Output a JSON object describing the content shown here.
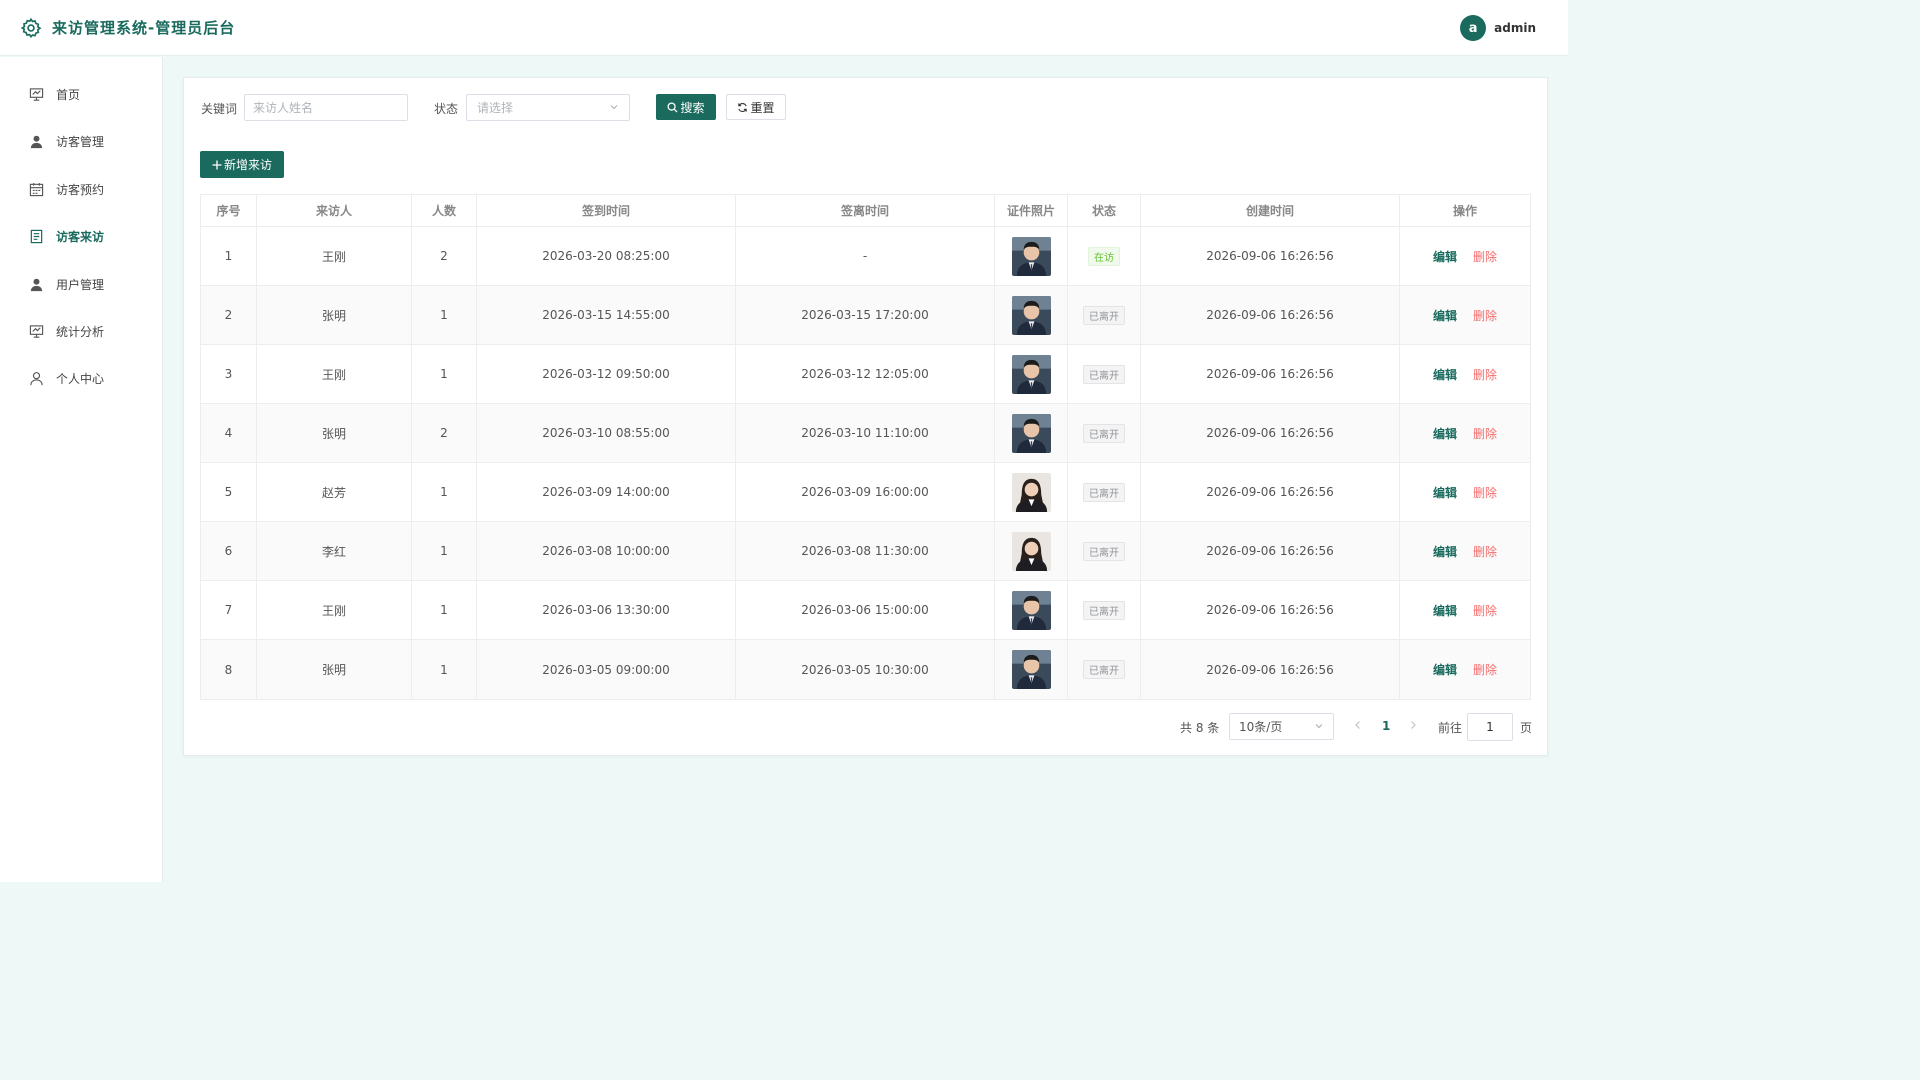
{
  "app": {
    "title": "来访管理系统-管理员后台"
  },
  "user": {
    "avatar_letter": "a",
    "name": "admin"
  },
  "sidebar": {
    "items": [
      {
        "label": "首页",
        "icon": "presentation-icon"
      },
      {
        "label": "访客管理",
        "icon": "user-icon"
      },
      {
        "label": "访客预约",
        "icon": "calendar-icon"
      },
      {
        "label": "访客来访",
        "icon": "document-icon",
        "active": true
      },
      {
        "label": "用户管理",
        "icon": "user-icon"
      },
      {
        "label": "统计分析",
        "icon": "presentation-icon"
      },
      {
        "label": "个人中心",
        "icon": "user-outline-icon"
      }
    ]
  },
  "filters": {
    "keyword_label": "关键词",
    "keyword_placeholder": "来访人姓名",
    "status_label": "状态",
    "status_placeholder": "请选择",
    "search_label": "搜索",
    "reset_label": "重置"
  },
  "toolbar": {
    "add_label": "新增来访"
  },
  "table": {
    "columns": [
      "序号",
      "来访人",
      "人数",
      "签到时间",
      "签离时间",
      "证件照片",
      "状态",
      "创建时间",
      "操作"
    ],
    "rows": [
      {
        "idx": "1",
        "name": "王刚",
        "count": "2",
        "checkin": "2026-03-20 08:25:00",
        "checkout": "-",
        "photo": "male",
        "status": "在访",
        "status_type": "in",
        "created": "2026-09-06 16:26:56"
      },
      {
        "idx": "2",
        "name": "张明",
        "count": "1",
        "checkin": "2026-03-15 14:55:00",
        "checkout": "2026-03-15 17:20:00",
        "photo": "male",
        "status": "已离开",
        "status_type": "out",
        "created": "2026-09-06 16:26:56"
      },
      {
        "idx": "3",
        "name": "王刚",
        "count": "1",
        "checkin": "2026-03-12 09:50:00",
        "checkout": "2026-03-12 12:05:00",
        "photo": "male",
        "status": "已离开",
        "status_type": "out",
        "created": "2026-09-06 16:26:56"
      },
      {
        "idx": "4",
        "name": "张明",
        "count": "2",
        "checkin": "2026-03-10 08:55:00",
        "checkout": "2026-03-10 11:10:00",
        "photo": "male",
        "status": "已离开",
        "status_type": "out",
        "created": "2026-09-06 16:26:56"
      },
      {
        "idx": "5",
        "name": "赵芳",
        "count": "1",
        "checkin": "2026-03-09 14:00:00",
        "checkout": "2026-03-09 16:00:00",
        "photo": "female",
        "status": "已离开",
        "status_type": "out",
        "created": "2026-09-06 16:26:56"
      },
      {
        "idx": "6",
        "name": "李红",
        "count": "1",
        "checkin": "2026-03-08 10:00:00",
        "checkout": "2026-03-08 11:30:00",
        "photo": "female",
        "status": "已离开",
        "status_type": "out",
        "created": "2026-09-06 16:26:56"
      },
      {
        "idx": "7",
        "name": "王刚",
        "count": "1",
        "checkin": "2026-03-06 13:30:00",
        "checkout": "2026-03-06 15:00:00",
        "photo": "male",
        "status": "已离开",
        "status_type": "out",
        "created": "2026-09-06 16:26:56"
      },
      {
        "idx": "8",
        "name": "张明",
        "count": "1",
        "checkin": "2026-03-05 09:00:00",
        "checkout": "2026-03-05 10:30:00",
        "photo": "male",
        "status": "已离开",
        "status_type": "out",
        "created": "2026-09-06 16:26:56"
      }
    ],
    "edit_label": "编辑",
    "delete_label": "删除"
  },
  "pagination": {
    "total_text": "共 8 条",
    "page_size": "10条/页",
    "current_page": "1",
    "goto_label": "前往",
    "goto_value": "1",
    "page_unit": "页"
  },
  "colors": {
    "primary": "#1a6b5e",
    "danger": "#f56c6c",
    "success": "#67c23a",
    "background": "#eef8f6"
  }
}
